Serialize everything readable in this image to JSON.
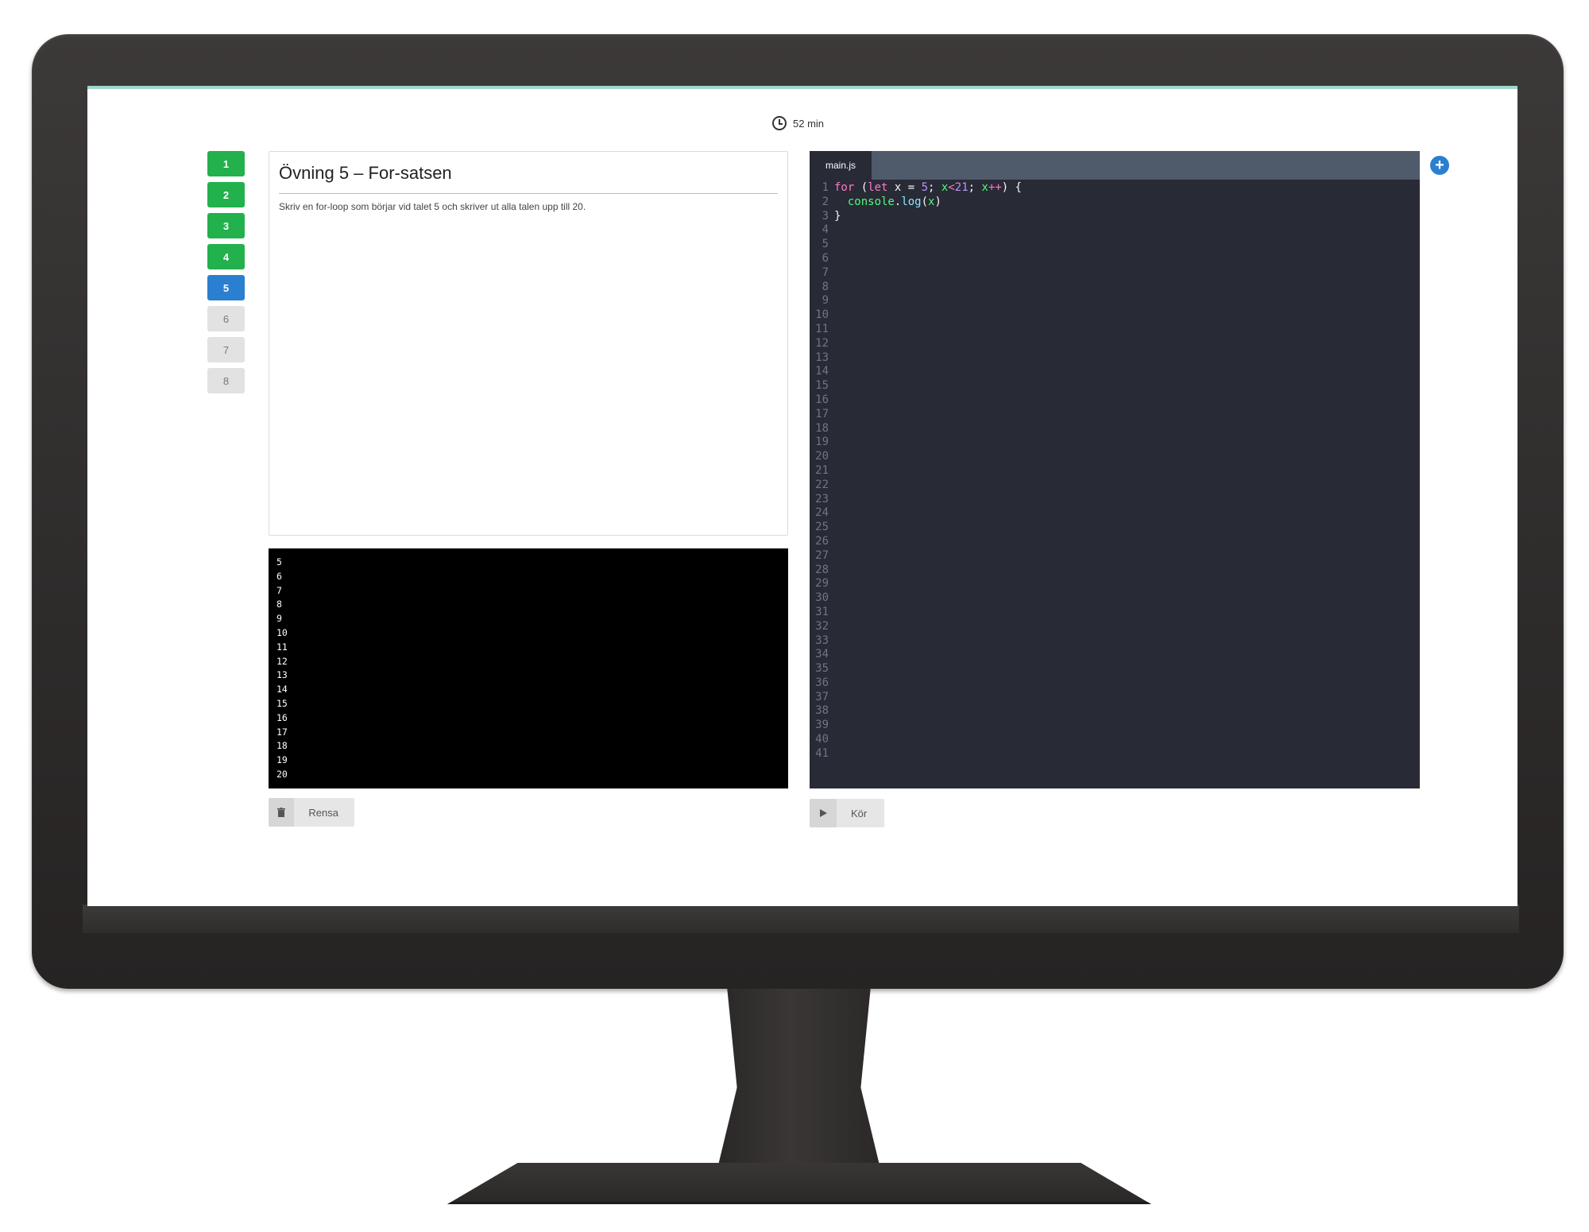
{
  "header": {
    "timer_text": "52 min",
    "icon": "clock-icon"
  },
  "steps": [
    {
      "label": "1",
      "state": "done"
    },
    {
      "label": "2",
      "state": "done"
    },
    {
      "label": "3",
      "state": "done"
    },
    {
      "label": "4",
      "state": "done"
    },
    {
      "label": "5",
      "state": "active"
    },
    {
      "label": "6",
      "state": "todo"
    },
    {
      "label": "7",
      "state": "todo"
    },
    {
      "label": "8",
      "state": "todo"
    }
  ],
  "exercise": {
    "title": "Övning 5 – For-satsen",
    "description": "Skriv en for-loop som börjar vid talet 5 och skriver ut alla talen upp till 20."
  },
  "console": {
    "output": [
      "5",
      "6",
      "7",
      "8",
      "9",
      "10",
      "11",
      "12",
      "13",
      "14",
      "15",
      "16",
      "17",
      "18",
      "19",
      "20"
    ]
  },
  "buttons": {
    "clear_label": "Rensa",
    "clear_icon": "trash-icon",
    "run_label": "Kör",
    "run_icon": "play-icon",
    "add_icon": "plus-icon"
  },
  "editor": {
    "tab_label": "main.js",
    "line_count": 41,
    "code": [
      [
        {
          "t": "for",
          "c": "kw"
        },
        {
          "t": " (",
          "c": ""
        },
        {
          "t": "let",
          "c": "kw"
        },
        {
          "t": " x = ",
          "c": ""
        },
        {
          "t": "5",
          "c": "num"
        },
        {
          "t": "; ",
          "c": ""
        },
        {
          "t": "x",
          "c": "var"
        },
        {
          "t": "<",
          "c": "kw"
        },
        {
          "t": "21",
          "c": "num"
        },
        {
          "t": "; ",
          "c": ""
        },
        {
          "t": "x",
          "c": "var"
        },
        {
          "t": "++",
          "c": "kw"
        },
        {
          "t": ") {",
          "c": ""
        }
      ],
      [
        {
          "t": "  ",
          "c": ""
        },
        {
          "t": "console",
          "c": "var"
        },
        {
          "t": ".",
          "c": ""
        },
        {
          "t": "log",
          "c": "fn"
        },
        {
          "t": "(",
          "c": ""
        },
        {
          "t": "x",
          "c": "var"
        },
        {
          "t": ")",
          "c": ""
        }
      ],
      [
        {
          "t": "}",
          "c": ""
        }
      ]
    ]
  },
  "colors": {
    "done": "#22b14c",
    "active": "#2a7fd0",
    "editor_bg": "#282a36",
    "tabbar_bg": "#4f5a6a",
    "accent_line": "#9fd6cb"
  }
}
